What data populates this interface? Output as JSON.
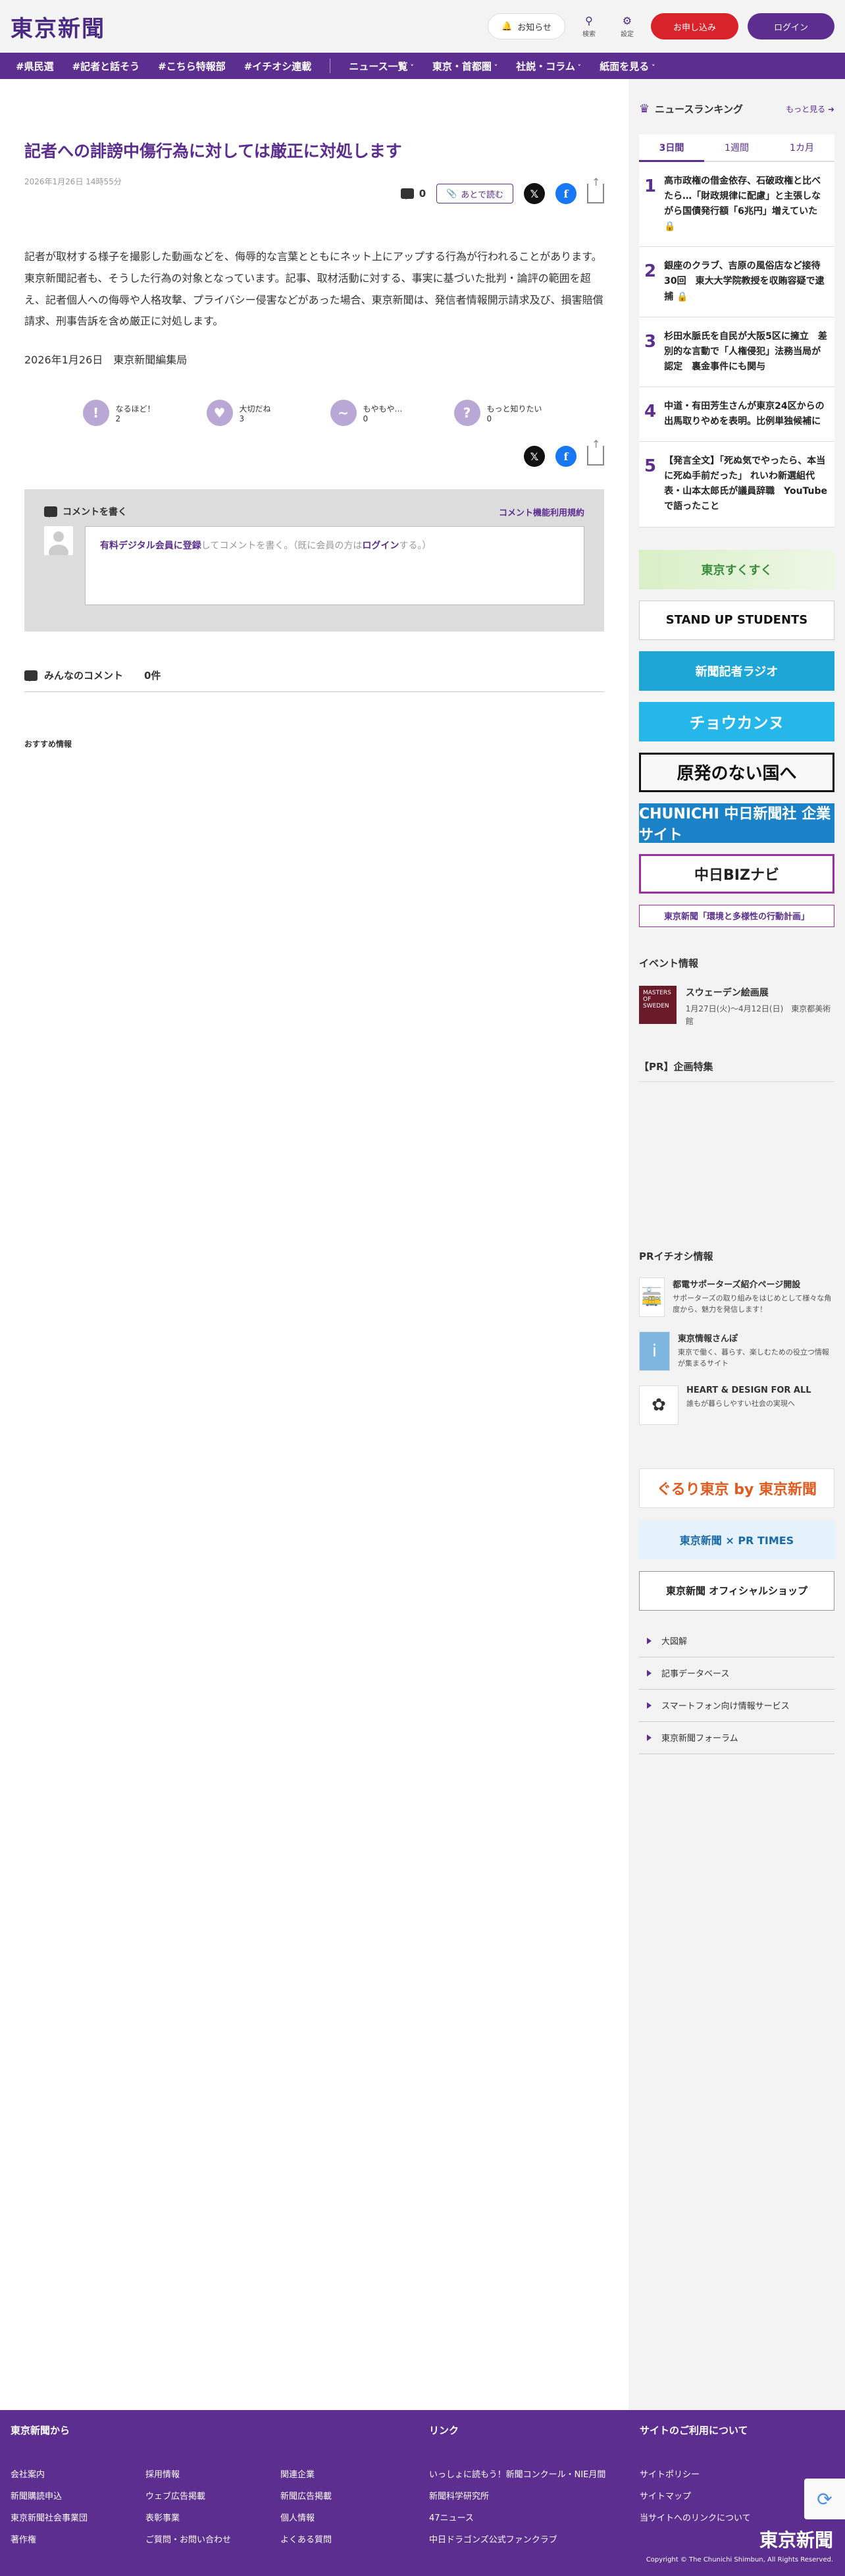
{
  "header": {
    "logo": "東京新聞",
    "notice": "お知らせ",
    "search": "検索",
    "settings": "設定",
    "apply": "お申し込み",
    "login": "ログイン"
  },
  "nav": [
    "#県民選",
    "#記者と話そう",
    "#こちら特報部",
    "#イチオシ連載"
  ],
  "nav_dd": [
    "ニュース一覧",
    "東京・首都圏",
    "社説・コラム",
    "紙面を見る"
  ],
  "article": {
    "title": "記者への誹謗中傷行為に対しては厳正に対処します",
    "date": "2026年1月26日 14時55分",
    "comment_count": "0",
    "read_later": "あとで読む",
    "body": "記者が取材する様子を撮影した動画などを、侮辱的な言葉とともにネット上にアップする行為が行われることがあります。東京新聞記者も、そうした行為の対象となっています。記事、取材活動に対する、事実に基づいた批判・論評の範囲を超え、記者個人への侮辱や人格攻撃、プライバシー侵害などがあった場合、東京新聞は、発信者情報開示請求及び、損害賠償請求、刑事告訴を含め厳正に対処します。",
    "sign": "2026年1月26日　東京新聞編集局"
  },
  "reactions": [
    {
      "label": "なるほど！",
      "count": "2",
      "glyph": "!"
    },
    {
      "label": "大切だね",
      "count": "3",
      "glyph": "♥"
    },
    {
      "label": "もやもや…",
      "count": "0",
      "glyph": "~"
    },
    {
      "label": "もっと知りたい",
      "count": "0",
      "glyph": "?"
    }
  ],
  "comments": {
    "write": "コメントを書く",
    "rules": "コメント機能利用規約",
    "input_link1": "有料デジタル会員に登録",
    "input_mid": "してコメントを書く。（既に会員の方は",
    "input_link2": "ログイン",
    "input_end": "する。）",
    "all": "みんなのコメント",
    "all_count": "0件",
    "recommend": "おすすめ情報"
  },
  "ranking": {
    "title": "ニュースランキング",
    "more": "もっと見る",
    "tabs": [
      "3日間",
      "1週間",
      "1カ月"
    ],
    "items": [
      {
        "no": "1",
        "text": "高市政権の借金依存、石破政権と比べたら…「財政規律に配慮」と主張しながら国債発行額「6兆円」増えていた 🔒"
      },
      {
        "no": "2",
        "text": "銀座のクラブ、吉原の風俗店など接待30回　東大大学院教授を収賄容疑で逮捕 🔒"
      },
      {
        "no": "3",
        "text": "杉田水脈氏を自民が大阪5区に擁立　差別的な言動で「人権侵犯」法務当局が認定　裏金事件にも関与"
      },
      {
        "no": "4",
        "text": "中道・有田芳生さんが東京24区からの出馬取りやめを表明。比例単独候補に"
      },
      {
        "no": "5",
        "text": "【発言全文】「死ぬ気でやったら、本当に死ぬ手前だった」 れいわ新選組代表・山本太郎氏が議員辞職　YouTubeで語ったこと"
      }
    ]
  },
  "banners": [
    "東京すくすく",
    "STAND UP STUDENTS",
    "新聞記者ラジオ",
    "チョウカンヌ",
    "原発のない国へ",
    "CHUNICHI 中日新聞社 企業サイト",
    "中日BIZナビ",
    "東京新聞「環境と多様性の行動計画」"
  ],
  "event": {
    "section": "イベント情報",
    "img_text": "MASTERS OF SWEDEN",
    "title": "スウェーデン絵画展",
    "meta": "1月27日(火)〜4月12日(日)　東京都美術館"
  },
  "pr_plan": "【PR】企画特集",
  "pr_pick": {
    "section": "PRイチオシ情報",
    "items": [
      {
        "title": "都電サポーターズ紹介ページ開設",
        "desc": "サポーターズの取り組みをはじめとして様々な角度から、魅力を発信します！",
        "glyph": "🚋"
      },
      {
        "title": "東京情報さんぽ",
        "desc": "東京で働く、暮らす、楽しむための役立つ情報が集まるサイト",
        "glyph": "i"
      },
      {
        "title": "HEART & DESIGN FOR ALL",
        "desc": "誰もが暮らしやすい社会の実現へ",
        "glyph": "✿"
      }
    ]
  },
  "banners2": [
    "ぐるり東京 by 東京新聞",
    "東京新聞 × PR TIMES",
    "東京新聞 オフィシャルショップ"
  ],
  "side_links": [
    "大図解",
    "記事データベース",
    "スマートフォン向け情報サービス",
    "東京新聞フォーラム"
  ],
  "footer": {
    "from": "東京新聞から",
    "from_links": [
      "会社案内",
      "採用情報",
      "関連企業",
      "新聞購読申込",
      "ウェブ広告掲載",
      "新聞広告掲載",
      "東京新聞社会事業団",
      "表彰事業",
      "個人情報",
      "著作権",
      "ご質問・お問い合わせ",
      "よくある質問"
    ],
    "link": "リンク",
    "link_items": [
      "いっしょに読もう！新聞コンクール・NIE月間",
      "新聞科学研究所",
      "47ニュース",
      "中日ドラゴンズ公式ファンクラブ"
    ],
    "usage": "サイトのご利用について",
    "usage_items": [
      "サイトポリシー",
      "サイトマップ",
      "当サイトへのリンクについて"
    ],
    "logo": "東京新聞",
    "copyright": "Copyright © The Chunichi Shimbun, All Rights Reserved."
  }
}
